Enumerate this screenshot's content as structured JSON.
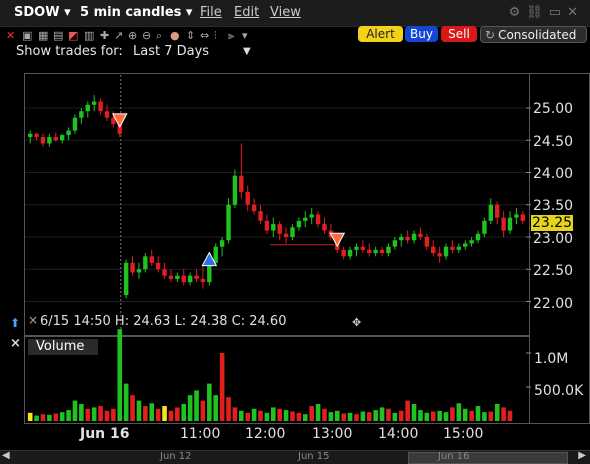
{
  "titlebar": {
    "symbol": "SDOW ▾",
    "interval": "5 min candles ▾",
    "menu_file": "File",
    "menu_edit": "Edit",
    "menu_view": "View"
  },
  "toolbar": {
    "alert_label": "Alert",
    "buy_label": "Buy",
    "sell_label": "Sell",
    "consolidated_label": "Consolidated"
  },
  "show_trades": {
    "label": "Show trades for:",
    "value": "Last 7 Days"
  },
  "price_axis": {
    "ticks": [
      "25.00",
      "24.50",
      "24.00",
      "23.50",
      "23.00",
      "22.50",
      "22.00"
    ],
    "current_price": "23.25"
  },
  "volume_axis": {
    "ticks": [
      "1.0M",
      "500.0K"
    ]
  },
  "time_axis": {
    "ticks": [
      "Jun 16",
      "11:00",
      "12:00",
      "13:00",
      "14:00",
      "15:00"
    ]
  },
  "info_line": "6/15 14:50  H: 24.63  L: 24.38  C: 24.60",
  "volume_panel_label": "Volume",
  "scroll_dates": [
    "Jun 12",
    "Jun 15",
    "Jun 16"
  ],
  "colors": {
    "up": "#1fc21f",
    "down": "#e01f1f",
    "neutral_vol": "#f5e51e",
    "price_tag": "#e6d41c"
  },
  "chart_data": {
    "type": "candlestick",
    "interval": "5 min",
    "ylim": [
      21.7,
      25.3
    ],
    "candles": [
      {
        "o": 24.55,
        "h": 24.65,
        "l": 24.45,
        "c": 24.6
      },
      {
        "o": 24.6,
        "h": 24.62,
        "l": 24.5,
        "c": 24.55
      },
      {
        "o": 24.55,
        "h": 24.6,
        "l": 24.4,
        "c": 24.45
      },
      {
        "o": 24.45,
        "h": 24.6,
        "l": 24.4,
        "c": 24.55
      },
      {
        "o": 24.55,
        "h": 24.62,
        "l": 24.48,
        "c": 24.5
      },
      {
        "o": 24.5,
        "h": 24.6,
        "l": 24.45,
        "c": 24.58
      },
      {
        "o": 24.58,
        "h": 24.7,
        "l": 24.5,
        "c": 24.65
      },
      {
        "o": 24.65,
        "h": 24.9,
        "l": 24.6,
        "c": 24.85
      },
      {
        "o": 24.85,
        "h": 25.0,
        "l": 24.75,
        "c": 24.95
      },
      {
        "o": 24.95,
        "h": 25.1,
        "l": 24.85,
        "c": 25.05
      },
      {
        "o": 25.05,
        "h": 25.2,
        "l": 24.95,
        "c": 25.1
      },
      {
        "o": 25.1,
        "h": 25.15,
        "l": 24.9,
        "c": 24.95
      },
      {
        "o": 24.95,
        "h": 25.05,
        "l": 24.8,
        "c": 24.85
      },
      {
        "o": 24.85,
        "h": 24.95,
        "l": 24.7,
        "c": 24.75
      },
      {
        "o": 24.75,
        "h": 24.8,
        "l": 24.55,
        "c": 24.6
      },
      {
        "o": 22.1,
        "h": 22.65,
        "l": 22.05,
        "c": 22.6
      },
      {
        "o": 22.6,
        "h": 22.7,
        "l": 22.4,
        "c": 22.45
      },
      {
        "o": 22.45,
        "h": 22.6,
        "l": 22.35,
        "c": 22.5
      },
      {
        "o": 22.5,
        "h": 22.75,
        "l": 22.45,
        "c": 22.7
      },
      {
        "o": 22.7,
        "h": 22.8,
        "l": 22.55,
        "c": 22.6
      },
      {
        "o": 22.6,
        "h": 22.7,
        "l": 22.45,
        "c": 22.5
      },
      {
        "o": 22.5,
        "h": 22.6,
        "l": 22.35,
        "c": 22.4
      },
      {
        "o": 22.4,
        "h": 22.5,
        "l": 22.3,
        "c": 22.35
      },
      {
        "o": 22.35,
        "h": 22.45,
        "l": 22.3,
        "c": 22.4
      },
      {
        "o": 22.4,
        "h": 22.5,
        "l": 22.25,
        "c": 22.3
      },
      {
        "o": 22.3,
        "h": 22.45,
        "l": 22.25,
        "c": 22.4
      },
      {
        "o": 22.4,
        "h": 22.5,
        "l": 22.3,
        "c": 22.35
      },
      {
        "o": 22.35,
        "h": 22.55,
        "l": 22.2,
        "c": 22.3
      },
      {
        "o": 22.3,
        "h": 22.7,
        "l": 22.25,
        "c": 22.6
      },
      {
        "o": 22.6,
        "h": 22.9,
        "l": 22.55,
        "c": 22.85
      },
      {
        "o": 22.85,
        "h": 23.0,
        "l": 22.7,
        "c": 22.95
      },
      {
        "o": 22.95,
        "h": 23.6,
        "l": 22.9,
        "c": 23.5
      },
      {
        "o": 23.5,
        "h": 24.05,
        "l": 23.45,
        "c": 23.95
      },
      {
        "o": 23.95,
        "h": 24.45,
        "l": 23.6,
        "c": 23.7
      },
      {
        "o": 23.7,
        "h": 23.8,
        "l": 23.4,
        "c": 23.5
      },
      {
        "o": 23.5,
        "h": 23.6,
        "l": 23.35,
        "c": 23.4
      },
      {
        "o": 23.4,
        "h": 23.5,
        "l": 23.2,
        "c": 23.25
      },
      {
        "o": 23.25,
        "h": 23.35,
        "l": 23.05,
        "c": 23.1
      },
      {
        "o": 23.1,
        "h": 23.3,
        "l": 23.0,
        "c": 23.2
      },
      {
        "o": 23.2,
        "h": 23.25,
        "l": 22.95,
        "c": 23.05
      },
      {
        "o": 23.05,
        "h": 23.15,
        "l": 22.9,
        "c": 23.0
      },
      {
        "o": 23.0,
        "h": 23.2,
        "l": 22.95,
        "c": 23.15
      },
      {
        "o": 23.15,
        "h": 23.3,
        "l": 23.1,
        "c": 23.25
      },
      {
        "o": 23.25,
        "h": 23.4,
        "l": 23.15,
        "c": 23.3
      },
      {
        "o": 23.3,
        "h": 23.45,
        "l": 23.2,
        "c": 23.35
      },
      {
        "o": 23.35,
        "h": 23.4,
        "l": 23.15,
        "c": 23.2
      },
      {
        "o": 23.2,
        "h": 23.3,
        "l": 23.05,
        "c": 23.1
      },
      {
        "o": 23.1,
        "h": 23.2,
        "l": 22.95,
        "c": 23.0
      },
      {
        "o": 23.0,
        "h": 23.05,
        "l": 22.75,
        "c": 22.8
      },
      {
        "o": 22.8,
        "h": 22.85,
        "l": 22.65,
        "c": 22.7
      },
      {
        "o": 22.7,
        "h": 22.85,
        "l": 22.65,
        "c": 22.8
      },
      {
        "o": 22.8,
        "h": 22.9,
        "l": 22.7,
        "c": 22.85
      },
      {
        "o": 22.85,
        "h": 22.95,
        "l": 22.75,
        "c": 22.8
      },
      {
        "o": 22.8,
        "h": 22.9,
        "l": 22.7,
        "c": 22.75
      },
      {
        "o": 22.75,
        "h": 22.85,
        "l": 22.7,
        "c": 22.8
      },
      {
        "o": 22.8,
        "h": 22.85,
        "l": 22.7,
        "c": 22.75
      },
      {
        "o": 22.75,
        "h": 22.9,
        "l": 22.7,
        "c": 22.85
      },
      {
        "o": 22.85,
        "h": 23.0,
        "l": 22.8,
        "c": 22.95
      },
      {
        "o": 22.95,
        "h": 23.05,
        "l": 22.85,
        "c": 23.0
      },
      {
        "o": 23.0,
        "h": 23.1,
        "l": 22.9,
        "c": 22.95
      },
      {
        "o": 22.95,
        "h": 23.1,
        "l": 22.9,
        "c": 23.05
      },
      {
        "o": 23.05,
        "h": 23.15,
        "l": 22.95,
        "c": 23.0
      },
      {
        "o": 23.0,
        "h": 23.05,
        "l": 22.8,
        "c": 22.85
      },
      {
        "o": 22.85,
        "h": 22.95,
        "l": 22.7,
        "c": 22.75
      },
      {
        "o": 22.75,
        "h": 22.85,
        "l": 22.6,
        "c": 22.7
      },
      {
        "o": 22.7,
        "h": 22.9,
        "l": 22.65,
        "c": 22.85
      },
      {
        "o": 22.85,
        "h": 22.95,
        "l": 22.75,
        "c": 22.8
      },
      {
        "o": 22.8,
        "h": 22.9,
        "l": 22.75,
        "c": 22.85
      },
      {
        "o": 22.85,
        "h": 22.95,
        "l": 22.8,
        "c": 22.9
      },
      {
        "o": 22.9,
        "h": 23.0,
        "l": 22.85,
        "c": 22.95
      },
      {
        "o": 22.95,
        "h": 23.1,
        "l": 22.9,
        "c": 23.05
      },
      {
        "o": 23.05,
        "h": 23.3,
        "l": 23.0,
        "c": 23.25
      },
      {
        "o": 23.25,
        "h": 23.6,
        "l": 23.2,
        "c": 23.5
      },
      {
        "o": 23.5,
        "h": 23.55,
        "l": 23.2,
        "c": 23.3
      },
      {
        "o": 23.3,
        "h": 23.4,
        "l": 23.0,
        "c": 23.1
      },
      {
        "o": 23.1,
        "h": 23.4,
        "l": 23.05,
        "c": 23.3
      },
      {
        "o": 23.3,
        "h": 23.45,
        "l": 23.2,
        "c": 23.35
      },
      {
        "o": 23.35,
        "h": 23.4,
        "l": 23.2,
        "c": 23.25
      }
    ],
    "volume": [
      {
        "v": 120000,
        "d": "n"
      },
      {
        "v": 80000,
        "d": "g"
      },
      {
        "v": 100000,
        "d": "r"
      },
      {
        "v": 90000,
        "d": "g"
      },
      {
        "v": 110000,
        "d": "r"
      },
      {
        "v": 130000,
        "d": "g"
      },
      {
        "v": 160000,
        "d": "g"
      },
      {
        "v": 300000,
        "d": "g"
      },
      {
        "v": 250000,
        "d": "g"
      },
      {
        "v": 180000,
        "d": "r"
      },
      {
        "v": 200000,
        "d": "g"
      },
      {
        "v": 220000,
        "d": "r"
      },
      {
        "v": 150000,
        "d": "r"
      },
      {
        "v": 180000,
        "d": "r"
      },
      {
        "v": 1350000,
        "d": "g"
      },
      {
        "v": 550000,
        "d": "g"
      },
      {
        "v": 380000,
        "d": "r"
      },
      {
        "v": 300000,
        "d": "g"
      },
      {
        "v": 220000,
        "d": "r"
      },
      {
        "v": 260000,
        "d": "g"
      },
      {
        "v": 180000,
        "d": "r"
      },
      {
        "v": 220000,
        "d": "n"
      },
      {
        "v": 150000,
        "d": "r"
      },
      {
        "v": 200000,
        "d": "r"
      },
      {
        "v": 250000,
        "d": "g"
      },
      {
        "v": 380000,
        "d": "g"
      },
      {
        "v": 450000,
        "d": "g"
      },
      {
        "v": 300000,
        "d": "r"
      },
      {
        "v": 550000,
        "d": "g"
      },
      {
        "v": 380000,
        "d": "g"
      },
      {
        "v": 1000000,
        "d": "r"
      },
      {
        "v": 350000,
        "d": "r"
      },
      {
        "v": 200000,
        "d": "r"
      },
      {
        "v": 150000,
        "d": "g"
      },
      {
        "v": 120000,
        "d": "r"
      },
      {
        "v": 180000,
        "d": "g"
      },
      {
        "v": 150000,
        "d": "r"
      },
      {
        "v": 120000,
        "d": "g"
      },
      {
        "v": 200000,
        "d": "g"
      },
      {
        "v": 180000,
        "d": "r"
      },
      {
        "v": 160000,
        "d": "g"
      },
      {
        "v": 140000,
        "d": "r"
      },
      {
        "v": 120000,
        "d": "r"
      },
      {
        "v": 100000,
        "d": "g"
      },
      {
        "v": 220000,
        "d": "r"
      },
      {
        "v": 250000,
        "d": "g"
      },
      {
        "v": 180000,
        "d": "r"
      },
      {
        "v": 130000,
        "d": "g"
      },
      {
        "v": 150000,
        "d": "g"
      },
      {
        "v": 110000,
        "d": "r"
      },
      {
        "v": 120000,
        "d": "g"
      },
      {
        "v": 100000,
        "d": "r"
      },
      {
        "v": 140000,
        "d": "g"
      },
      {
        "v": 130000,
        "d": "r"
      },
      {
        "v": 160000,
        "d": "g"
      },
      {
        "v": 200000,
        "d": "g"
      },
      {
        "v": 180000,
        "d": "r"
      },
      {
        "v": 120000,
        "d": "g"
      },
      {
        "v": 150000,
        "d": "r"
      },
      {
        "v": 300000,
        "d": "r"
      },
      {
        "v": 250000,
        "d": "g"
      },
      {
        "v": 160000,
        "d": "g"
      },
      {
        "v": 120000,
        "d": "g"
      },
      {
        "v": 140000,
        "d": "r"
      },
      {
        "v": 150000,
        "d": "g"
      },
      {
        "v": 130000,
        "d": "g"
      },
      {
        "v": 200000,
        "d": "r"
      },
      {
        "v": 260000,
        "d": "g"
      },
      {
        "v": 180000,
        "d": "g"
      },
      {
        "v": 150000,
        "d": "r"
      },
      {
        "v": 220000,
        "d": "g"
      },
      {
        "v": 130000,
        "d": "g"
      },
      {
        "v": 140000,
        "d": "r"
      },
      {
        "v": 250000,
        "d": "g"
      },
      {
        "v": 200000,
        "d": "r"
      },
      {
        "v": 150000,
        "d": "r"
      }
    ],
    "price_ticks": [
      25.0,
      24.5,
      24.0,
      23.5,
      23.0,
      22.5,
      22.0
    ],
    "trade_markers": [
      {
        "type": "sell",
        "index": 14,
        "price": 24.8
      },
      {
        "type": "buy",
        "index": 28,
        "price": 22.65
      },
      {
        "type": "sell",
        "index": 48,
        "price": 22.95
      }
    ],
    "reference_line": {
      "price": 22.88,
      "from_index": 38,
      "to_index": 48
    }
  }
}
